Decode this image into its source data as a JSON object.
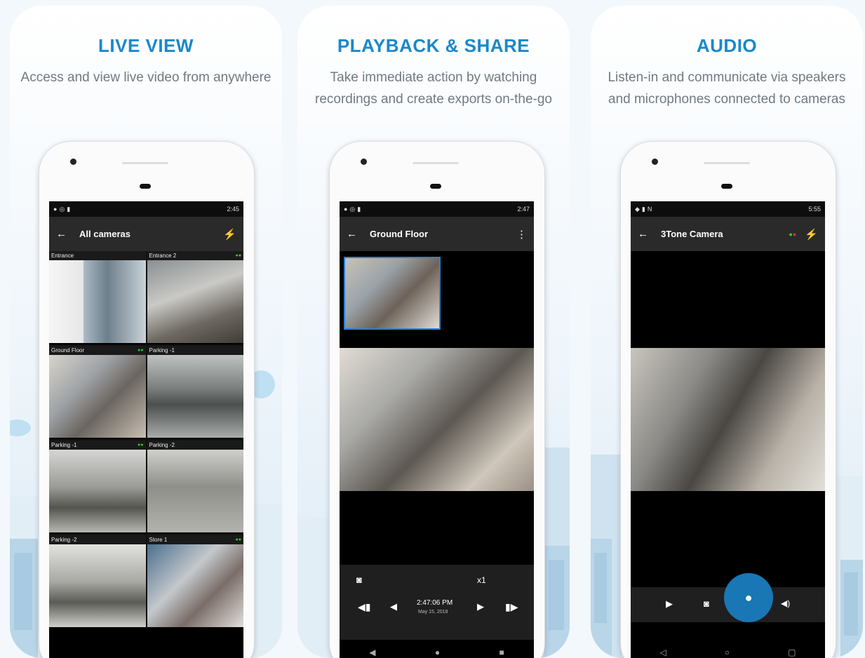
{
  "panels": [
    {
      "title": "LIVE VIEW",
      "subtitle": "Access and view live video from anywhere",
      "status_time": "2:45",
      "toolbar_title": "All cameras",
      "cameras": [
        {
          "label": "Entrance"
        },
        {
          "label": "Entrance 2"
        },
        {
          "label": "Ground Floor"
        },
        {
          "label": "Parking -1"
        },
        {
          "label": "Parking -1"
        },
        {
          "label": "Parking -2"
        },
        {
          "label": "Parking -2"
        },
        {
          "label": "Store 1"
        }
      ]
    },
    {
      "title": "PLAYBACK & SHARE",
      "subtitle": "Take immediate action by watching recordings and create exports on-the-go",
      "status_time": "2:47",
      "toolbar_title": "Ground Floor",
      "speed": "x1",
      "time": "2:47:06 PM",
      "date": "May 15, 2018"
    },
    {
      "title": "AUDIO",
      "subtitle": "Listen-in and communicate via speakers and microphones connected to cameras",
      "status_time": "5:55",
      "toolbar_title": "3Tone Camera"
    }
  ],
  "icons": {
    "back": "back-arrow-icon",
    "flash": "lightning-icon",
    "more": "more-vert-icon",
    "snapshot": "camera-icon",
    "mic": "mic-icon",
    "speaker": "speaker-icon",
    "play": "play-icon"
  },
  "colors": {
    "accent": "#1a88c9",
    "fab": "#1877b4",
    "subtitle": "#707a82"
  }
}
